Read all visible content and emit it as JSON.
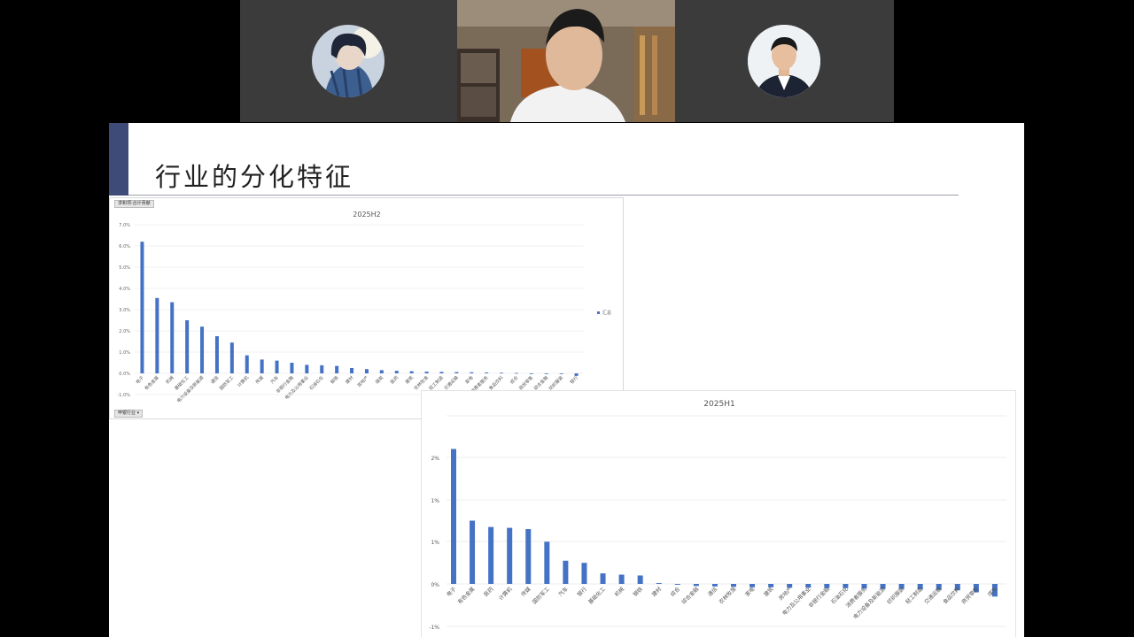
{
  "participants": [
    {
      "name": "participant-anime-avatar",
      "kind": "avatar"
    },
    {
      "name": "participant-presenter",
      "kind": "video"
    },
    {
      "name": "participant-profile-photo",
      "kind": "avatar"
    }
  ],
  "slide": {
    "title": "行业的分化特征",
    "chart1_filter_label": "求和项:合计贡献",
    "chart1_legend_label": "汇总",
    "chart1_axis_filter_label": "申银行业"
  },
  "colors": {
    "bar": "#4472c4",
    "slide_accent": "#3e4a78",
    "meeting_tile": "#3b3b3b"
  },
  "chart_data": [
    {
      "type": "bar",
      "title": "2025H2",
      "legend": [
        "汇总"
      ],
      "categories": [
        "电子",
        "有色金属",
        "机械",
        "基础化工",
        "电力设备及新能源",
        "通信",
        "国防军工",
        "计算机",
        "传媒",
        "汽车",
        "非银行金融",
        "电力及公用事业",
        "石油石化",
        "钢铁",
        "建材",
        "房地产",
        "煤炭",
        "医药",
        "建筑",
        "农林牧渔",
        "轻工制造",
        "交通运输",
        "家电",
        "消费者服务",
        "食品饮料",
        "综合",
        "商贸零售",
        "综合金融",
        "纺织服装",
        "银行"
      ],
      "values": [
        6.2,
        3.55,
        3.35,
        2.5,
        2.2,
        1.75,
        1.45,
        0.85,
        0.65,
        0.6,
        0.5,
        0.4,
        0.38,
        0.35,
        0.25,
        0.2,
        0.15,
        0.12,
        0.1,
        0.08,
        0.07,
        0.06,
        0.05,
        0.04,
        0.03,
        0.02,
        0.0,
        0.0,
        -0.02,
        -0.12
      ],
      "ylim": [
        -1.0,
        7.0
      ],
      "yticks": [
        "7.0%",
        "6.0%",
        "5.0%",
        "4.0%",
        "3.0%",
        "2.0%",
        "1.0%",
        "0.0%",
        "-1.0%"
      ]
    },
    {
      "type": "bar",
      "title": "2025H1",
      "categories": [
        "电子",
        "有色金属",
        "医药",
        "计算机",
        "传媒",
        "国防军工",
        "汽车",
        "银行",
        "基础化工",
        "机械",
        "钢铁",
        "建材",
        "综合",
        "综合金融",
        "通信",
        "农林牧渔",
        "家电",
        "建筑",
        "房地产",
        "电力及公用事业",
        "非银行金融",
        "石油石化",
        "消费者服务",
        "电力设备及新能源",
        "纺织服装",
        "轻工制造",
        "交通运输",
        "食品饮料",
        "商贸零售",
        "煤炭"
      ],
      "values": [
        3.2,
        1.5,
        1.35,
        1.33,
        1.3,
        1.0,
        0.55,
        0.5,
        0.25,
        0.22,
        0.2,
        0.02,
        -0.02,
        -0.05,
        -0.06,
        -0.07,
        -0.08,
        -0.08,
        -0.09,
        -0.09,
        -0.1,
        -0.1,
        -0.11,
        -0.12,
        -0.12,
        -0.13,
        -0.14,
        -0.15,
        -0.2,
        -0.3
      ],
      "ytick_values": [
        2,
        1,
        0,
        -1
      ],
      "yticks": [
        "2%",
        "1%",
        "1%",
        "0%",
        "-1%"
      ],
      "ylim": [
        -1.0,
        4.0
      ]
    }
  ]
}
